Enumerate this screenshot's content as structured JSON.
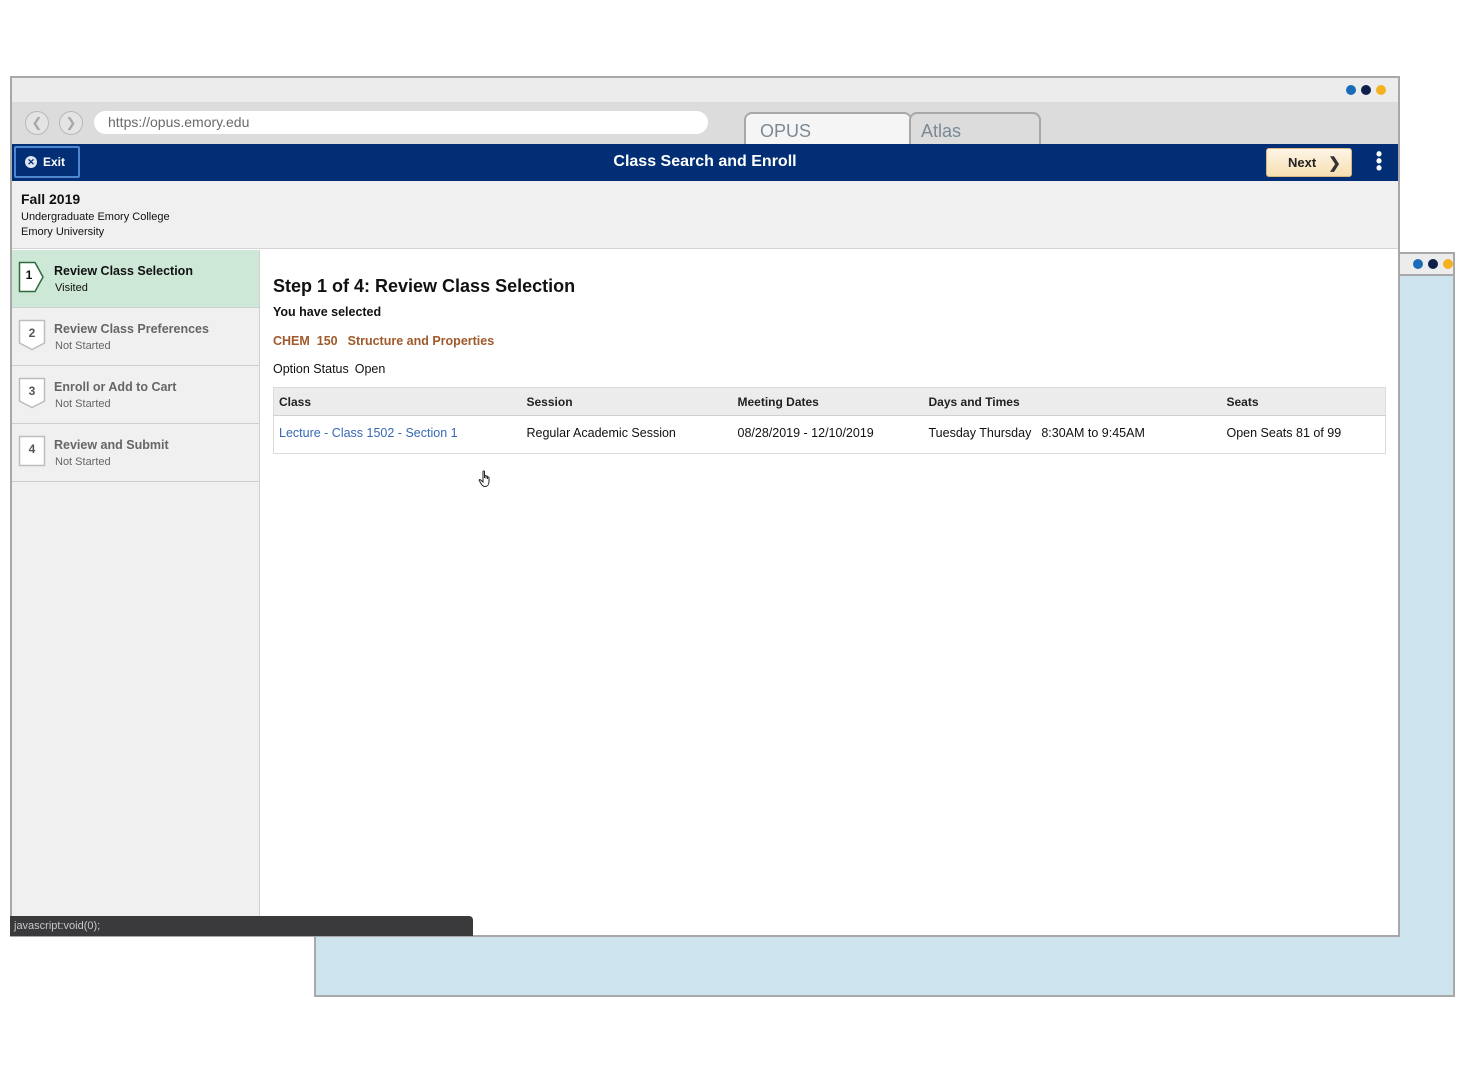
{
  "background_window": {
    "dots": [
      "#1a6bb8",
      "#0f1f4a",
      "#f4b223"
    ]
  },
  "browser": {
    "dots": [
      "#1a6bb8",
      "#0f1f4a",
      "#f4b223"
    ],
    "back_icon": "chevron-left-icon",
    "forward_icon": "chevron-right-icon",
    "url": "https://opus.emory.edu",
    "tabs": [
      {
        "label": "OPUS",
        "active": true
      },
      {
        "label": "Atlas",
        "active": false
      }
    ]
  },
  "header": {
    "exit_label": "Exit",
    "title": "Class Search and Enroll",
    "next_label": "Next",
    "accent": "#012e74"
  },
  "context": {
    "term": "Fall 2019",
    "career": "Undergraduate Emory College",
    "institution": "Emory University"
  },
  "steps": [
    {
      "num": "1",
      "label": "Review Class Selection",
      "status": "Visited",
      "active": true
    },
    {
      "num": "2",
      "label": "Review Class Preferences",
      "status": "Not Started",
      "active": false
    },
    {
      "num": "3",
      "label": "Enroll or Add to Cart",
      "status": "Not Started",
      "active": false
    },
    {
      "num": "4",
      "label": "Review and Submit",
      "status": "Not Started",
      "active": false
    }
  ],
  "main": {
    "heading": "Step 1 of 4: Review Class Selection",
    "selected_label": "You have selected",
    "course_code": "CHEM  150",
    "course_title": "Structure and Properties",
    "option_status_label": "Option Status",
    "option_status_value": "Open",
    "table": {
      "headers": [
        "Class",
        "Session",
        "Meeting Dates",
        "Days and Times",
        "Seats"
      ],
      "rows": [
        {
          "class": "Lecture - Class 1502 - Section 1",
          "session": "Regular Academic Session",
          "dates": "08/28/2019 - 12/10/2019",
          "days": "Tuesday Thursday",
          "times": "8:30AM to 9:45AM",
          "seats": "Open Seats 81 of 99"
        }
      ]
    }
  },
  "status_bar": {
    "text": "javascript:void(0);"
  }
}
